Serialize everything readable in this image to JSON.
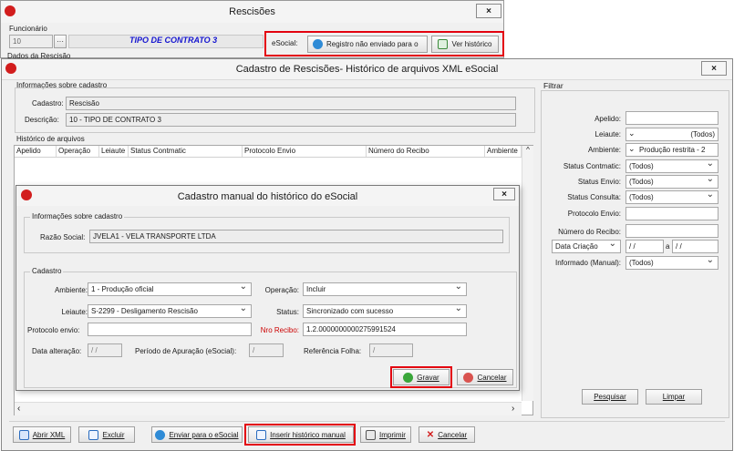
{
  "back_window": {
    "title": "Rescisões",
    "funcionario_label": "Funcionário",
    "funcionario_value": "10",
    "contract_type": "TIPO DE CONTRATO 3",
    "esocial_label": "eSocial:",
    "status_button": "Registro não enviado para o",
    "history_button": "Ver histórico",
    "dados_label": "Dados da Rescisão"
  },
  "main_window": {
    "title": "Cadastro de Rescisões- Histórico de arquivos XML eSocial",
    "info_group": "Informações sobre cadastro",
    "cadastro_label": "Cadastro:",
    "cadastro_value": "Rescisão",
    "descricao_label": "Descrição:",
    "descricao_value": "10 - TIPO DE CONTRATO 3",
    "historico_group": "Histórico de arquivos",
    "columns": [
      "Apelido",
      "Operação",
      "Leiaute",
      "Status Contmatic",
      "Protocolo Envio",
      "Número do Recibo",
      "Ambiente"
    ],
    "filter": {
      "title": "Filtrar",
      "apelido_label": "Apelido:",
      "leiaute_label": "Leiaute:",
      "leiaute_value": "(Todos)",
      "ambiente_label": "Ambiente:",
      "ambiente_value": "Produção restrita - 2",
      "status_contmatic_label": "Status Contmatic:",
      "status_contmatic_value": "(Todos)",
      "status_envio_label": "Status Envio:",
      "status_envio_value": "(Todos)",
      "status_consulta_label": "Status Consulta:",
      "status_consulta_value": "(Todos)",
      "protocolo_label": "Protocolo Envio:",
      "recibo_label": "Número do Recibo:",
      "data_criacao": "Data Criação",
      "date_from": "/ /",
      "date_sep": "a",
      "date_to": "/ /",
      "informado_label": "Informado (Manual):",
      "informado_value": "(Todos)",
      "pesquisar": "Pesquisar",
      "limpar": "Limpar"
    },
    "bottom_buttons": {
      "abrir_xml": "Abrir XML",
      "excluir": "Excluir",
      "enviar": "Enviar para o eSocial",
      "inserir": "Inserir histórico manual",
      "imprimir": "Imprimir",
      "cancelar": "Cancelar"
    }
  },
  "dialog": {
    "title": "Cadastro manual do histórico do eSocial",
    "info_group": "Informações sobre cadastro",
    "razao_label": "Razão Social:",
    "razao_value": "JVELA1 - VELA TRANSPORTE LTDA",
    "cadastro_group": "Cadastro",
    "ambiente_label": "Ambiente:",
    "ambiente_value": "1 - Produção oficial",
    "operacao_label": "Operação:",
    "operacao_value": "Incluir",
    "leiaute_label": "Leiaute:",
    "leiaute_value": "S-2299 - Desligamento Rescisão",
    "status_label": "Status:",
    "status_value": "Sincronizado com sucesso",
    "protocolo_label": "Protocolo envio:",
    "protocolo_value": "",
    "recibo_label": "Nro Recibo:",
    "recibo_value": "1.2.0000000000275991524",
    "data_alt_label": "Data alteração:",
    "data_alt_value": "/ /",
    "periodo_label": "Período de Apuração (eSocial):",
    "periodo_value": "/",
    "referencia_label": "Referência Folha:",
    "referencia_value": "/",
    "gravar": "Gravar",
    "cancelar": "Cancelar"
  },
  "colors": {
    "highlight": "#e3000f",
    "title_blue": "#1515d0",
    "recibo_red": "#cc0000"
  }
}
